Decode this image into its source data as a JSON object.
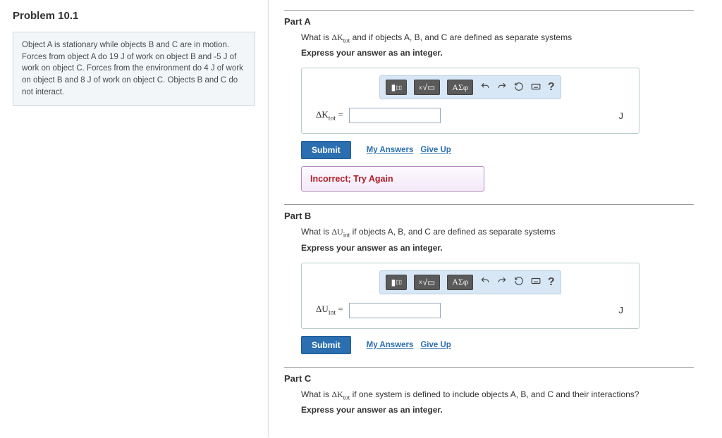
{
  "problem": {
    "title": "Problem 10.1",
    "description": "Object A is stationary while objects B and C are in motion. Forces from object A do 19 J of work on object B and -5 J of work on object C. Forces from the environment do 4 J of work on object B and 8 J of work on object C. Objects B and C do not interact."
  },
  "parts": {
    "a": {
      "header": "Part A",
      "question_prefix": "What is ",
      "question_var_html": "ΔK",
      "question_var_sub": "tot",
      "question_suffix": " and if objects A, B, and C are defined as separate systems",
      "instruct": "Express your answer as an integer.",
      "var_label_html": "ΔK",
      "var_label_sub": "tot",
      "equals": " =",
      "unit": "J",
      "submit": "Submit",
      "my_answers": "My Answers",
      "give_up": "Give Up",
      "feedback": "Incorrect; Try Again"
    },
    "b": {
      "header": "Part B",
      "question_prefix": "What is ",
      "question_var_html": "ΔU",
      "question_var_sub": "int",
      "question_suffix": " if objects A, B, and C are defined as separate systems",
      "instruct": "Express your answer as an integer.",
      "var_label_html": "ΔU",
      "var_label_sub": "int",
      "equals": " =",
      "unit": "J",
      "submit": "Submit",
      "my_answers": "My Answers",
      "give_up": "Give Up"
    },
    "c": {
      "header": "Part C",
      "question_prefix": "What is ",
      "question_var_html": "ΔK",
      "question_var_sub": "tot",
      "question_suffix": " if one system is defined to include objects A, B, and C and their interactions?",
      "instruct": "Express your answer as an integer."
    }
  },
  "toolbar": {
    "template_btn": "T",
    "root_btn": "√",
    "greek_btn": "ΑΣφ",
    "help_btn": "?"
  }
}
